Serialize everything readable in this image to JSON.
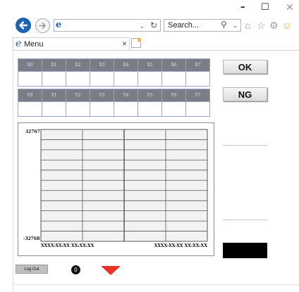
{
  "browser": {
    "address_value": "",
    "search_placeholder": "Search...",
    "tab_title": "Menu",
    "tab_close": "×",
    "refresh_glyph": "↻",
    "dropdown_glyph": "⌄",
    "window_controls": {
      "minimize": "–",
      "maximize": "☐",
      "close": "✕"
    },
    "toolbar_icons": [
      "home-icon",
      "favorites-star-icon",
      "settings-gear-icon",
      "feedback-smiley-icon"
    ]
  },
  "io_table": {
    "inputs": [
      "X0",
      "X1",
      "X2",
      "X3",
      "X4",
      "X5",
      "X6",
      "X7"
    ],
    "outputs": [
      "Y0",
      "Y1",
      "Y2",
      "Y3",
      "Y4",
      "Y5",
      "Y6",
      "Y7"
    ]
  },
  "buttons": {
    "ok": "OK",
    "ng": "NG",
    "logout": "Log Out"
  },
  "status_count": "0",
  "chart_data": {
    "type": "line",
    "title": "",
    "xlabel": "",
    "ylabel": "",
    "ylim": [
      -32768,
      32767
    ],
    "y_tick_labels": [
      "32767",
      "-32768"
    ],
    "x_tick_labels": [
      "XXXX-XX-XX XX:XX:XX",
      "XXXX-XX-XX XX:XX:XX"
    ],
    "grid": true,
    "series": []
  },
  "colors": {
    "header_fill": "#7a7c86",
    "alarm_arrow": "#e8322a",
    "back_button": "#1e63b3"
  }
}
